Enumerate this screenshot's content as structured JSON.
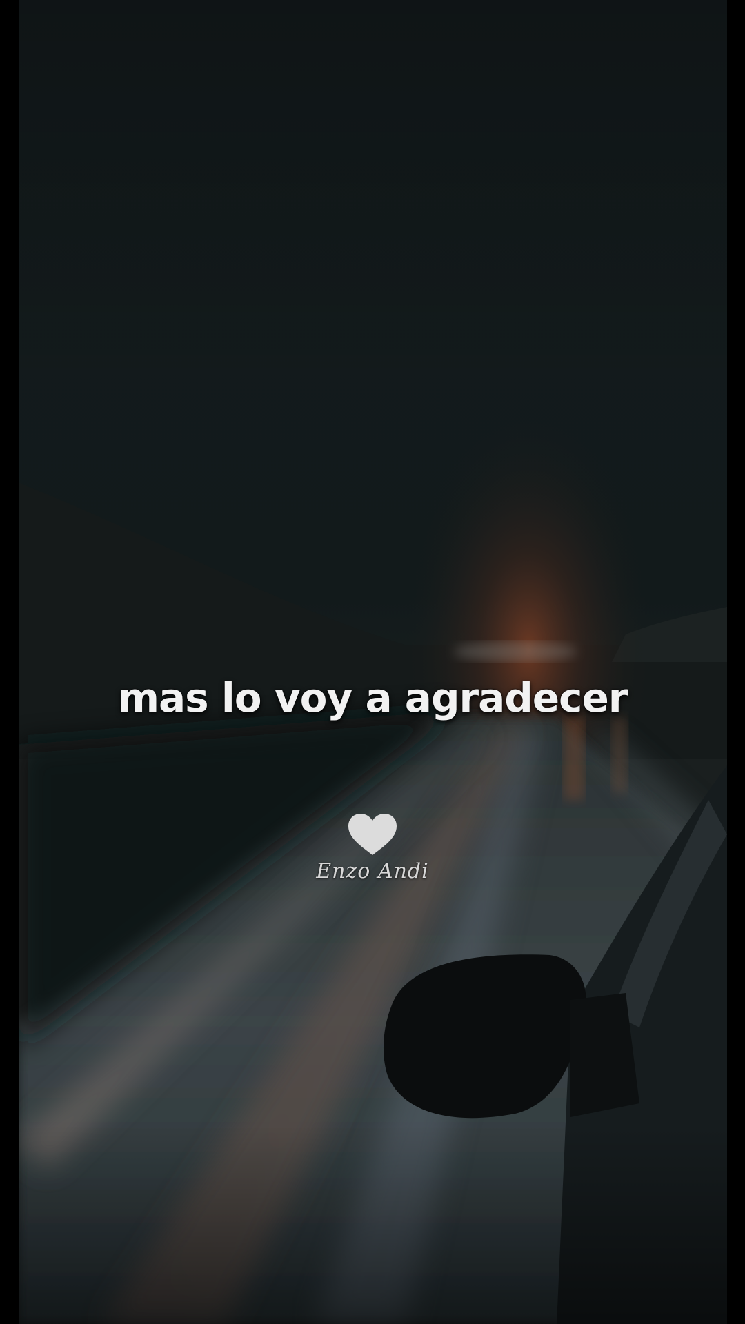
{
  "lyric": {
    "text": "mas lo voy a agradecer"
  },
  "watermark": {
    "icon": "heart-icon",
    "signature": "Enzo Andi",
    "heart_color": "#dcdcdc"
  },
  "scene": {
    "description_colors": {
      "sky": "#121a1b",
      "road": "#3a4548",
      "glow": "#7a3a22"
    }
  }
}
